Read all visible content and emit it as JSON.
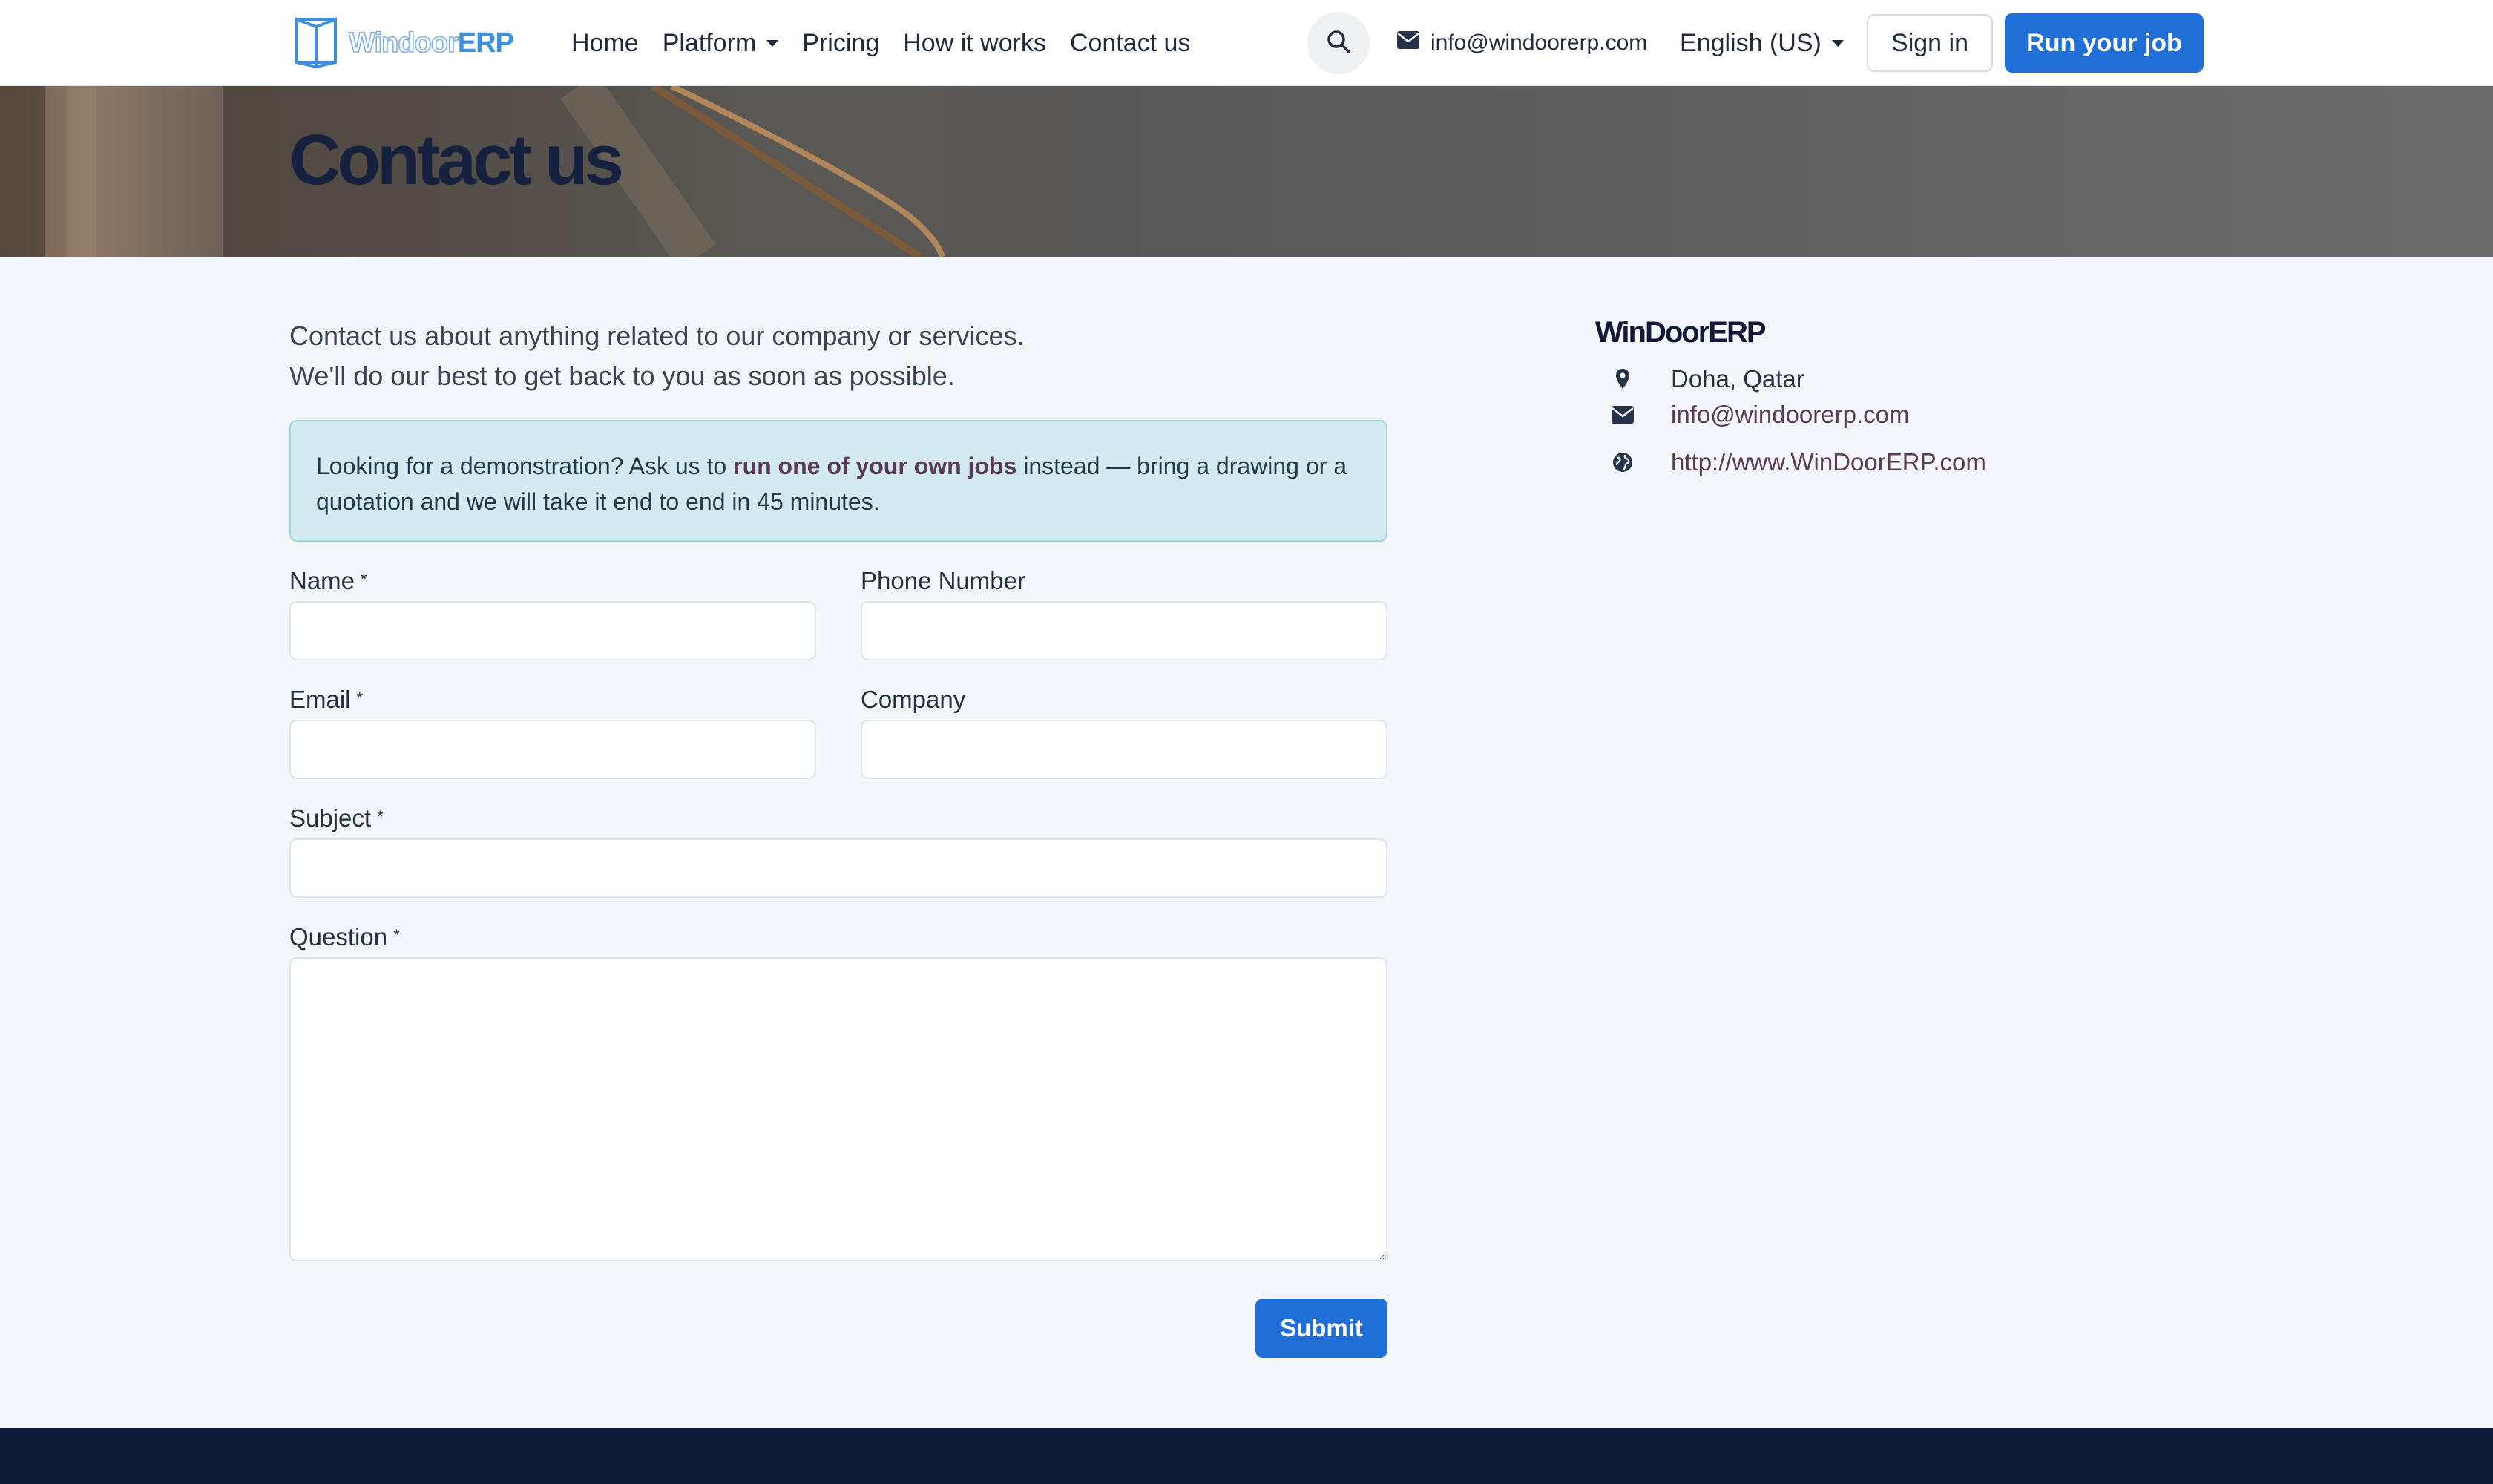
{
  "brand": {
    "logo_part1": "Windoor",
    "logo_part2": "ERP"
  },
  "nav": {
    "links": [
      "Home",
      "Platform",
      "Pricing",
      "How it works",
      "Contact us"
    ],
    "email": "info@windoorerp.com",
    "language": "English (US)",
    "signin": "Sign in",
    "cta": "Run your job"
  },
  "hero": {
    "title": "Contact us"
  },
  "intro": {
    "line1": "Contact us about anything related to our company or services.",
    "line2": "We'll do our best to get back to you as soon as possible."
  },
  "alert": {
    "before": "Looking for a demonstration? Ask us to ",
    "link": "run one of your own jobs",
    "after": " instead — bring a drawing or a quotation and we will take it end to end in 45 minutes."
  },
  "form": {
    "name_label": "Name",
    "phone_label": "Phone Number",
    "email_label": "Email",
    "company_label": "Company",
    "subject_label": "Subject",
    "question_label": "Question",
    "required_mark": "*",
    "submit": "Submit"
  },
  "company_info": {
    "name": "WinDoorERP",
    "address": "Doha, Qatar",
    "email": "info@windoorerp.com",
    "website": "http://www.WinDoorERP.com"
  },
  "colors": {
    "primary": "#1f6fd6",
    "footer": "#111b38",
    "page_bg": "#f3f7fc",
    "alert_bg": "#d2eaf0"
  }
}
